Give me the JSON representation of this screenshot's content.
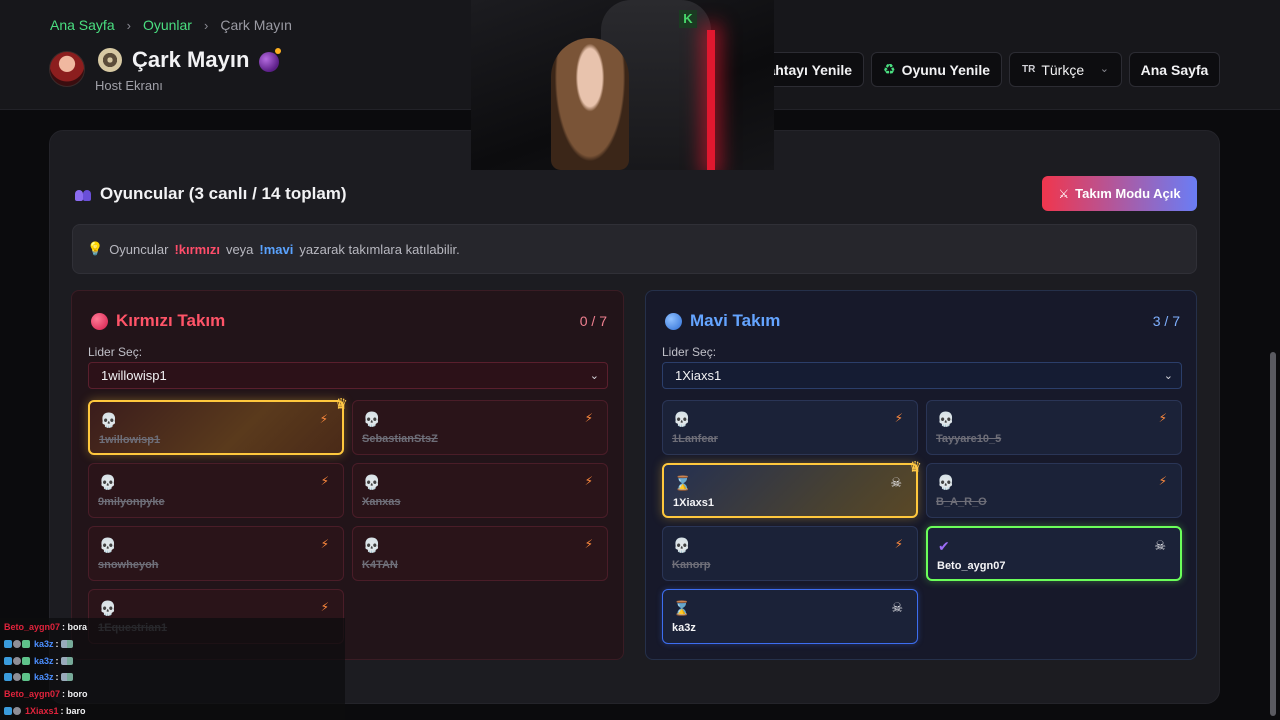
{
  "breadcrumb": {
    "home": "Ana Sayfa",
    "games": "Oyunlar",
    "current": "Çark Mayın",
    "sep": "›"
  },
  "header": {
    "title": "Çark Mayın",
    "subtitle": "Host Ekranı",
    "refresh_board": "Tahtayı Yenile",
    "refresh_game": "Oyunu Yenile",
    "language_code": "TR",
    "language": "Türkçe",
    "home": "Ana Sayfa"
  },
  "players": {
    "title": "Oyuncular (3 canlı / 14 toplam)",
    "team_mode_button": "Takım Modu Açık",
    "info_prefix": "Oyuncular",
    "cmd_red": "!kırmızı",
    "info_mid": "veya",
    "cmd_blue": "!mavi",
    "info_suffix": "yazarak takımlara katılabilir."
  },
  "red_team": {
    "name": "Kırmızı Takım",
    "count": "0 / 7",
    "leader_label": "Lider Seç:",
    "leader": "1willowisp1",
    "accent": "#ff5468",
    "cards": [
      {
        "name": "1willowisp1",
        "state": "dead",
        "leader": true
      },
      {
        "name": "SebastianStsZ",
        "state": "dead"
      },
      {
        "name": "9milyonpyke",
        "state": "dead"
      },
      {
        "name": "Xanxas",
        "state": "dead"
      },
      {
        "name": "snowheyoh",
        "state": "dead"
      },
      {
        "name": "K4TAN",
        "state": "dead"
      },
      {
        "name": "1Equestrian1",
        "state": "dead"
      }
    ]
  },
  "blue_team": {
    "name": "Mavi Takım",
    "count": "3 / 7",
    "leader_label": "Lider Seç:",
    "leader": "1Xiaxs1",
    "accent": "#64a4ff",
    "cards": [
      {
        "name": "1Lanfear",
        "state": "dead"
      },
      {
        "name": "Tayyare10_5",
        "state": "dead"
      },
      {
        "name": "1Xiaxs1",
        "state": "waiting",
        "leader": true
      },
      {
        "name": "B_A_R_O",
        "state": "dead"
      },
      {
        "name": "Kanorp",
        "state": "dead"
      },
      {
        "name": "Beto_aygn07",
        "state": "done"
      },
      {
        "name": "ka3z",
        "state": "waiting"
      }
    ]
  },
  "icons": {
    "dead": "skull-icon",
    "waiting": "hourglass-icon",
    "done": "check-icon",
    "action": "lightning-icon",
    "remove": "crossbones-icon",
    "leader": "crown-icon"
  },
  "chat": [
    {
      "user": "Beto_aygn07",
      "text": ": bora",
      "color": "red",
      "badges": false
    },
    {
      "user": "ka3z",
      "text": ":",
      "color": "blue",
      "badges": true,
      "emote": true
    },
    {
      "user": "ka3z",
      "text": ":",
      "color": "blue",
      "badges": true,
      "emote": true
    },
    {
      "user": "ka3z",
      "text": ":",
      "color": "blue",
      "badges": true,
      "emote": true
    },
    {
      "user": "Beto_aygn07",
      "text": ": boro",
      "color": "red",
      "badges": false
    },
    {
      "user": "1Xiaxs1",
      "text": ": baro",
      "color": "red",
      "badges": true
    }
  ]
}
